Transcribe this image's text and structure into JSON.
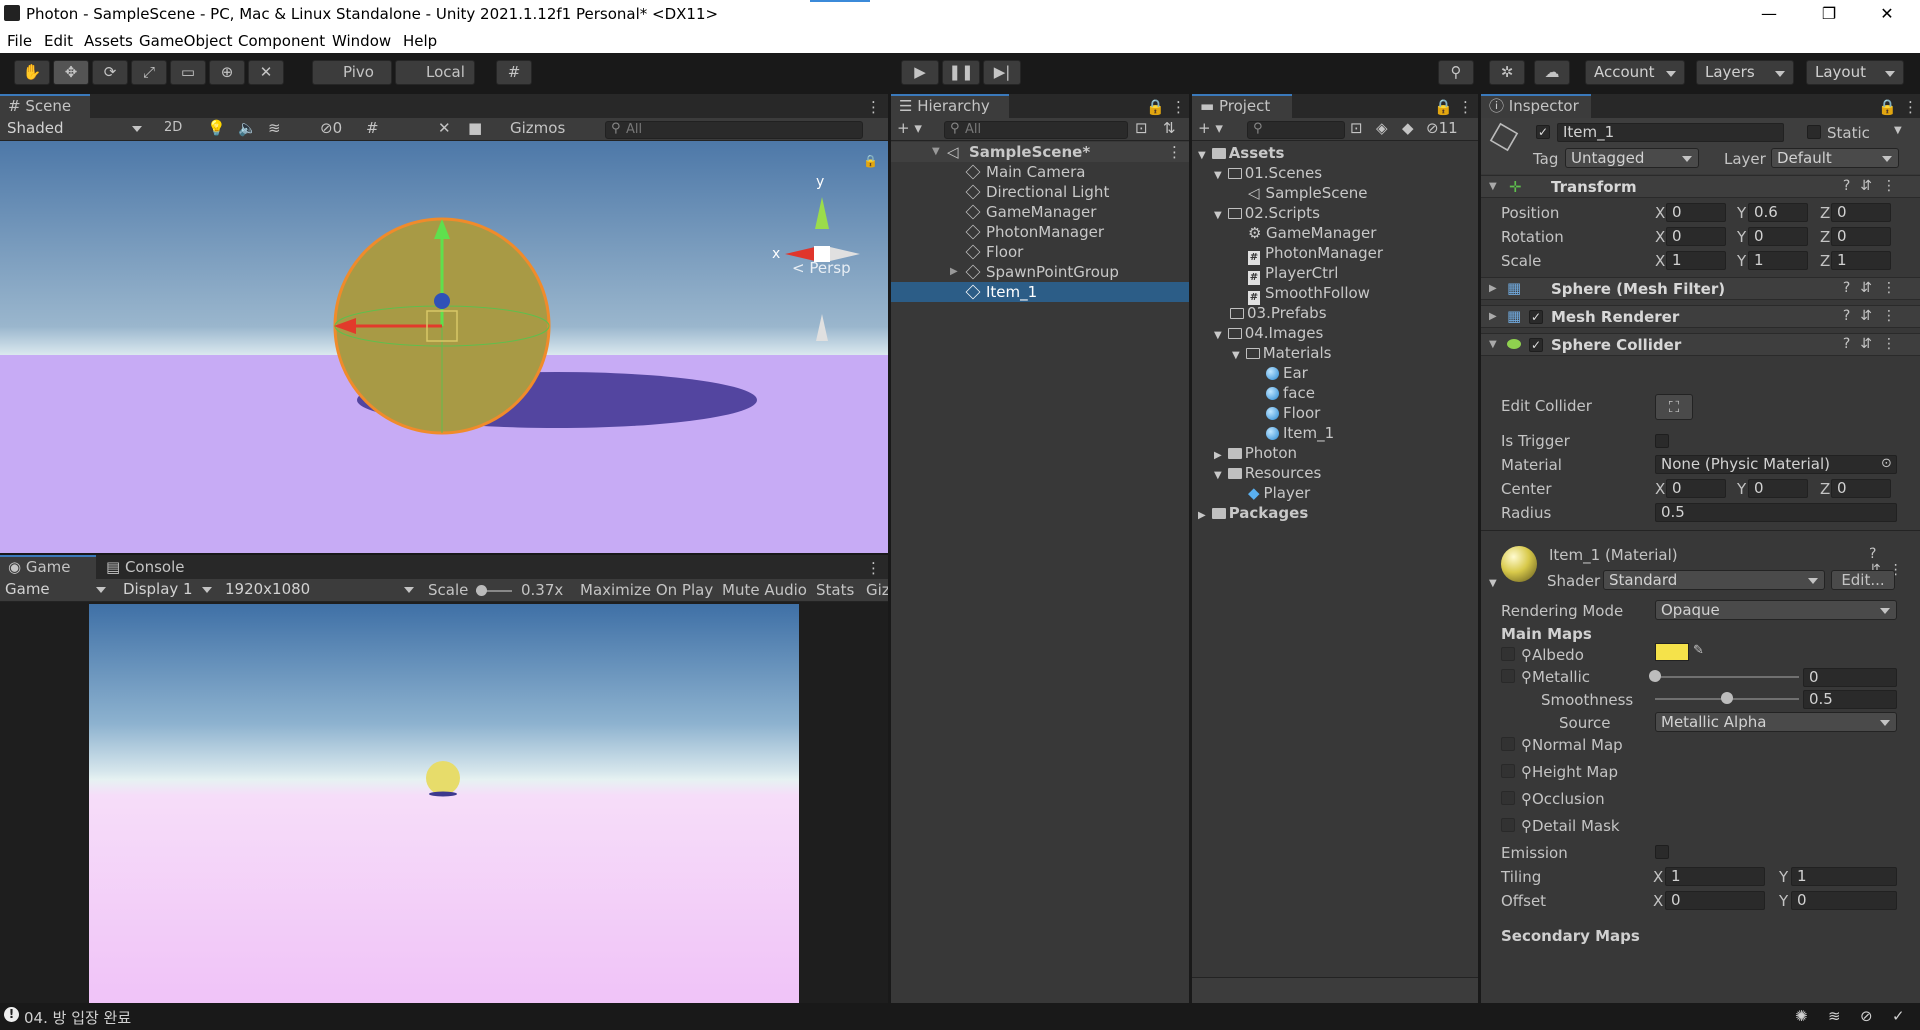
{
  "window": {
    "title": "Photon - SampleScene - PC, Mac & Linux Standalone - Unity 2021.1.12f1 Personal* <DX11>",
    "minimize": "—",
    "restore": "❐",
    "close": "✕"
  },
  "menu": [
    "File",
    "Edit",
    "Assets",
    "GameObject",
    "Component",
    "Window",
    "Help"
  ],
  "toolbar": {
    "pivot_label": "Pivo",
    "local_label": "Local",
    "account_label": "Account",
    "layers_label": "Layers",
    "layout_label": "Layout"
  },
  "scene": {
    "tab_label": "Scene",
    "shading": "Shaded",
    "mode_2d": "2D",
    "hidden_count": "0",
    "gizmos_label": "Gizmos",
    "search_placeholder": "All",
    "persp_label": "Persp",
    "axis_y": "y",
    "axis_x": "x"
  },
  "game": {
    "tab_label": "Game",
    "console_tab": "Console",
    "mode": "Game",
    "display": "Display 1",
    "resolution": "1920x1080",
    "scale_label": "Scale",
    "scale_value": "0.37x",
    "maximize": "Maximize On Play",
    "mute": "Mute Audio",
    "stats": "Stats",
    "gizmos": "Giz"
  },
  "hierarchy": {
    "tab_label": "Hierarchy",
    "search_placeholder": "All",
    "scene_name": "SampleScene*",
    "items": [
      "Main Camera",
      "Directional Light",
      "GameManager",
      "PhotonManager",
      "Floor",
      "SpawnPointGroup",
      "Item_1"
    ]
  },
  "project": {
    "tab_label": "Project",
    "hidden_count": "11",
    "assets": "Assets",
    "scenes_folder": "01.Scenes",
    "sample_scene": "SampleScene",
    "scripts_folder": "02.Scripts",
    "scripts": [
      "GameManager",
      "PhotonManager",
      "PlayerCtrl",
      "SmoothFollow"
    ],
    "prefabs_folder": "03.Prefabs",
    "images_folder": "04.Images",
    "materials_folder": "Materials",
    "materials": [
      "Ear",
      "face",
      "Floor",
      "Item_1"
    ],
    "photon_folder": "Photon",
    "resources_folder": "Resources",
    "player": "Player",
    "packages": "Packages"
  },
  "inspector": {
    "tab_label": "Inspector",
    "object_name": "Item_1",
    "static_label": "Static",
    "tag_label": "Tag",
    "tag_value": "Untagged",
    "layer_label": "Layer",
    "layer_value": "Default",
    "transform": {
      "title": "Transform",
      "position_label": "Position",
      "rotation_label": "Rotation",
      "scale_label": "Scale",
      "position": [
        "0",
        "0.6",
        "0"
      ],
      "rotation": [
        "0",
        "0",
        "0"
      ],
      "scale": [
        "1",
        "1",
        "1"
      ]
    },
    "mesh_filter_title": "Sphere (Mesh Filter)",
    "mesh_renderer_title": "Mesh Renderer",
    "collider": {
      "title": "Sphere Collider",
      "edit_label": "Edit Collider",
      "trigger_label": "Is Trigger",
      "material_label": "Material",
      "material_value": "None (Physic Material)",
      "center_label": "Center",
      "center": [
        "0",
        "0",
        "0"
      ],
      "radius_label": "Radius",
      "radius_value": "0.5"
    },
    "material": {
      "name": "Item_1 (Material)",
      "shader_label": "Shader",
      "shader_value": "Standard",
      "edit_button": "Edit...",
      "rendering_mode_label": "Rendering Mode",
      "rendering_mode_value": "Opaque",
      "main_maps": "Main Maps",
      "albedo": "Albedo",
      "albedo_color": "#f5e24a",
      "metallic": "Metallic",
      "metallic_value": "0",
      "metallic_level": 0,
      "smoothness": "Smoothness",
      "smoothness_value": "0.5",
      "smoothness_level": 0.5,
      "source_label": "Source",
      "source_value": "Metallic Alpha",
      "normal_map": "Normal Map",
      "height_map": "Height Map",
      "occlusion": "Occlusion",
      "detail_mask": "Detail Mask",
      "emission": "Emission",
      "tiling_label": "Tiling",
      "tiling": [
        "1",
        "1"
      ],
      "offset_label": "Offset",
      "offset": [
        "0",
        "0"
      ],
      "secondary_maps": "Secondary Maps",
      "axis_x": "X",
      "axis_y": "Y",
      "axis_z": "Z"
    }
  },
  "status": {
    "message": "04. 방 입장 완료"
  }
}
